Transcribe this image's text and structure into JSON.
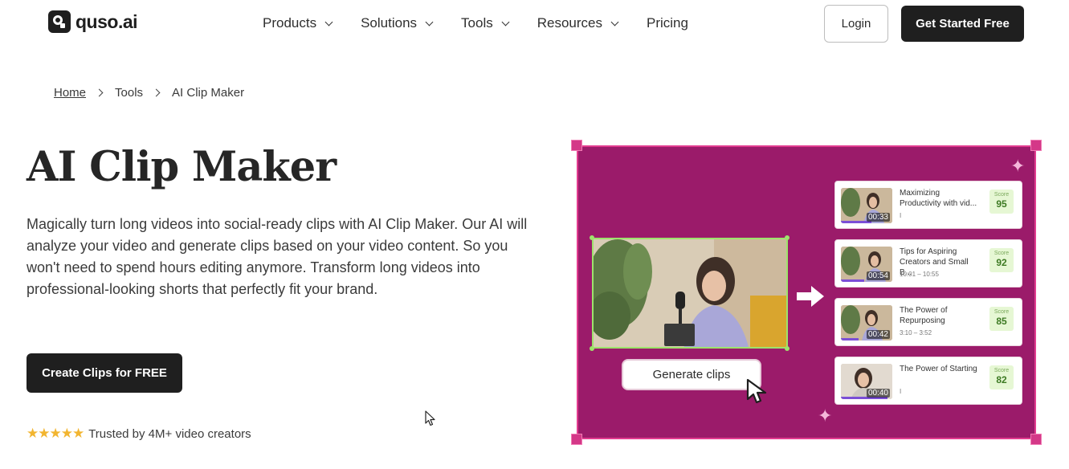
{
  "header": {
    "logo_text": "quso.ai",
    "nav": [
      {
        "label": "Products",
        "dropdown": true
      },
      {
        "label": "Solutions",
        "dropdown": true
      },
      {
        "label": "Tools",
        "dropdown": true
      },
      {
        "label": "Resources",
        "dropdown": true
      },
      {
        "label": "Pricing",
        "dropdown": false
      }
    ],
    "login_label": "Login",
    "get_started_label": "Get Started Free"
  },
  "breadcrumb": {
    "home": "Home",
    "tools": "Tools",
    "current": "AI Clip Maker"
  },
  "hero": {
    "title": "AI Clip Maker",
    "description": "Magically turn long videos into social-ready clips with AI Clip Maker. Our AI will analyze your video and generate clips based on your video content. So you won't need to spend hours editing anymore. Transform long videos into professional-looking shorts that perfectly fit your brand.",
    "cta_label": "Create Clips for FREE",
    "trust_text": "Trusted by 4M+ video creators",
    "rating_stars": 5
  },
  "visual": {
    "generate_label": "Generate clips",
    "clips": [
      {
        "title": "Maximizing Productivity with vid...",
        "sub": "I",
        "time": "00:33",
        "score_label": "Score",
        "score": "95",
        "progress": 0.6
      },
      {
        "title": "Tips for Aspiring Creators and Small B...",
        "sub": "10:01 – 10:55",
        "time": "00:54",
        "score_label": "Score",
        "score": "92",
        "progress": 0.45
      },
      {
        "title": "The Power of Repurposing",
        "sub": "3:10 – 3:52",
        "time": "00:42",
        "score_label": "Score",
        "score": "85",
        "progress": 0.35
      },
      {
        "title": "The Power of Starting",
        "sub": "I",
        "time": "00:40",
        "score_label": "Score",
        "score": "82",
        "progress": 0.9
      }
    ],
    "colors": {
      "background": "#9b1b6a",
      "accent": "#9ee36c",
      "score_bg": "#e6f7d4"
    }
  }
}
